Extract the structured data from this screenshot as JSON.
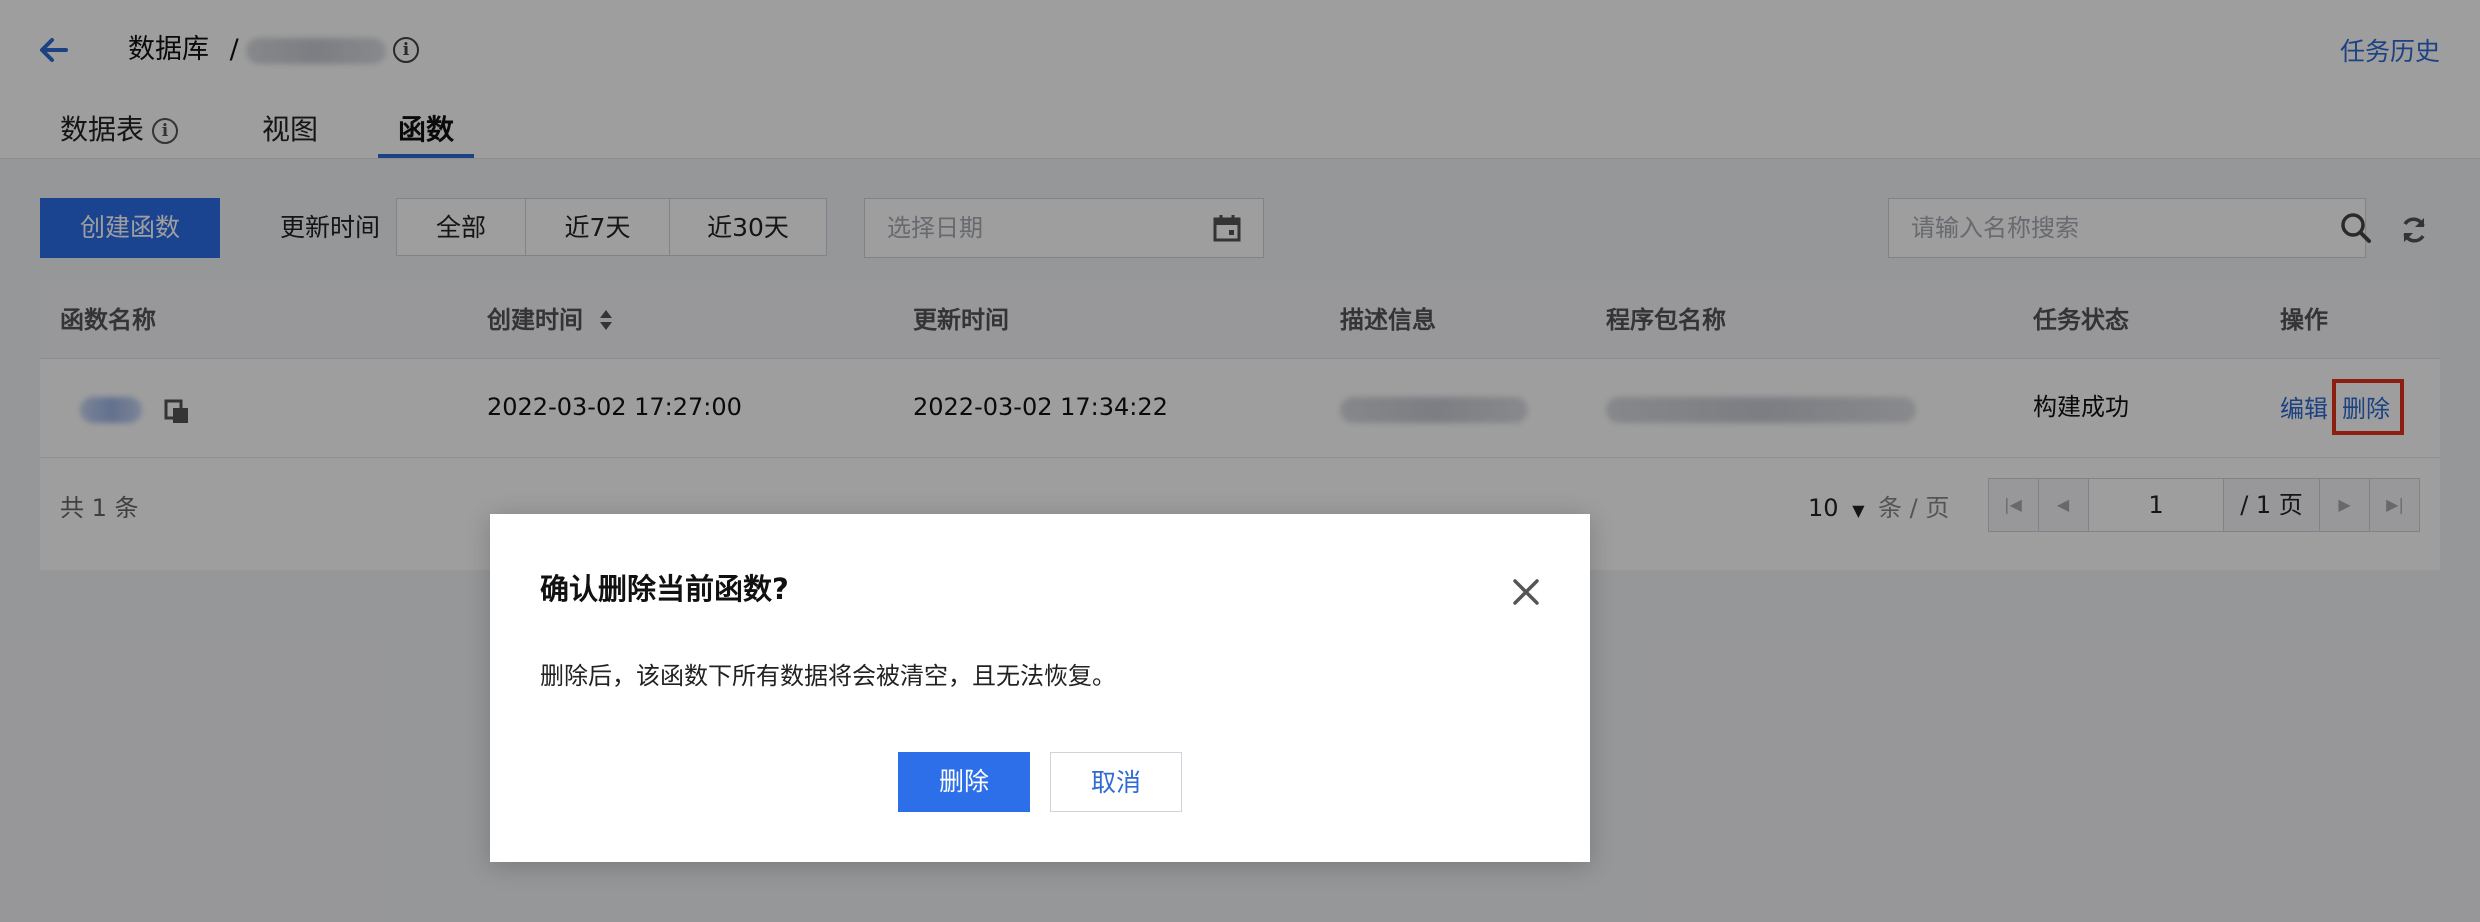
{
  "header": {
    "breadcrumb_root": "数据库",
    "breadcrumb_sep": "/",
    "task_history": "任务历史"
  },
  "tabs": [
    {
      "label": "数据表"
    },
    {
      "label": "视图"
    },
    {
      "label": "函数"
    }
  ],
  "toolbar": {
    "create_button": "创建函数",
    "update_time_label": "更新时间",
    "filters": [
      "全部",
      "近7天",
      "近30天"
    ],
    "date_placeholder": "选择日期",
    "search_placeholder": "请输入名称搜索"
  },
  "table": {
    "columns": [
      "函数名称",
      "创建时间",
      "更新时间",
      "描述信息",
      "程序包名称",
      "任务状态",
      "操作"
    ],
    "rows": [
      {
        "created": "2022-03-02 17:27:00",
        "updated": "2022-03-02 17:34:22",
        "status": "构建成功",
        "action_edit": "编辑",
        "action_delete": "删除"
      }
    ],
    "total": "共 1 条",
    "page_size": "10",
    "per_page_label": "条 / 页",
    "page": "1",
    "page_total": "/ 1 页"
  },
  "modal": {
    "title": "确认删除当前函数?",
    "body": "删除后，该函数下所有数据将会被清空，且无法恢复。",
    "confirm": "删除",
    "cancel": "取消"
  },
  "colors": {
    "primary": "#2c6fe8",
    "link": "#2e6bd4",
    "highlight": "#e0321e"
  }
}
